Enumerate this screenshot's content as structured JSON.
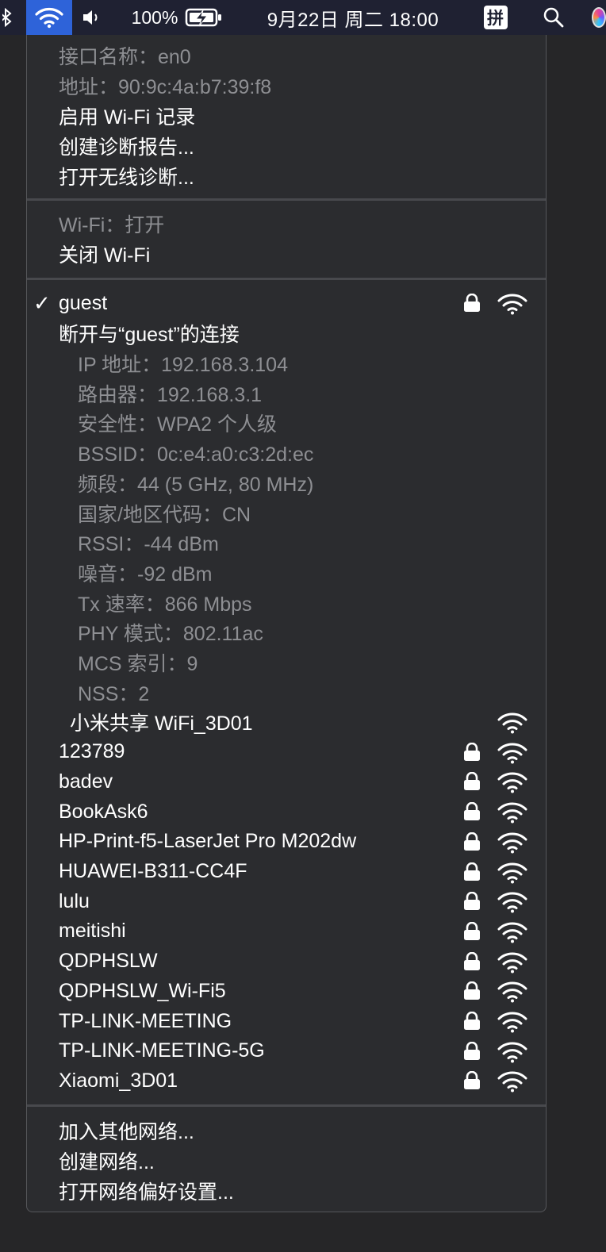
{
  "menubar": {
    "battery_percent": "100%",
    "datetime": "9月22日 周二  18:00",
    "input_method": "拼"
  },
  "info_section": {
    "interface_name": "接口名称：en0",
    "address": "地址：90:9c:4a:b7:39:f8",
    "enable_logging": "启用 Wi-Fi 记录",
    "create_diagnostics": "创建诊断报告...",
    "open_wireless_diagnostics": "打开无线诊断..."
  },
  "wifi_status": {
    "status": "Wi-Fi：打开",
    "turn_off": "关闭 Wi-Fi"
  },
  "connected": {
    "check": "✓",
    "name": "guest",
    "disconnect": "断开与“guest”的连接",
    "details": [
      "IP 地址：192.168.3.104",
      "路由器：192.168.3.1",
      "安全性：WPA2 个人级",
      "BSSID：0c:e4:a0:c3:2d:ec",
      "频段：44 (5 GHz, 80 MHz)",
      "国家/地区代码：CN",
      "RSSI：-44 dBm",
      "噪音：-92 dBm",
      "Tx 速率：866 Mbps",
      "PHY 模式：802.11ac",
      "MCS 索引：9",
      "NSS：2"
    ]
  },
  "networks": [
    {
      "name": "小米共享 WiFi_3D01",
      "locked": false
    },
    {
      "name": "123789",
      "locked": true
    },
    {
      "name": "badev",
      "locked": true
    },
    {
      "name": "BookAsk6",
      "locked": true
    },
    {
      "name": "HP-Print-f5-LaserJet Pro M202dw",
      "locked": true
    },
    {
      "name": "HUAWEI-B311-CC4F",
      "locked": true
    },
    {
      "name": "lulu",
      "locked": true
    },
    {
      "name": "meitishi",
      "locked": true
    },
    {
      "name": "QDPHSLW",
      "locked": true
    },
    {
      "name": "QDPHSLW_Wi-Fi5",
      "locked": true
    },
    {
      "name": "TP-LINK-MEETING",
      "locked": true
    },
    {
      "name": "TP-LINK-MEETING-5G",
      "locked": true
    },
    {
      "name": "Xiaomi_3D01",
      "locked": true
    }
  ],
  "footer": {
    "join_other": "加入其他网络...",
    "create_network": "创建网络...",
    "open_preferences": "打开网络偏好设置..."
  },
  "colors": {
    "menubar_bg": "#1f2132",
    "wifi_highlight": "#2e63d9",
    "menu_bg": "#2b2c2f",
    "dim_text": "#8e8f93"
  }
}
